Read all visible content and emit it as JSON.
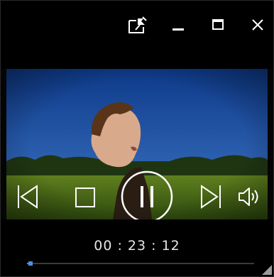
{
  "titlebar": {
    "icons": [
      "pin-icon",
      "minimize-icon",
      "maximize-icon",
      "close-icon"
    ]
  },
  "player": {
    "controls": [
      "previous-icon",
      "stop-icon",
      "pause-icon",
      "next-icon",
      "volume-icon"
    ],
    "time": "00 : 23 : 12",
    "progress": 0.015
  },
  "colors": {
    "background": "#000000",
    "accent": "#4a90e2",
    "foreground": "#ffffff"
  }
}
